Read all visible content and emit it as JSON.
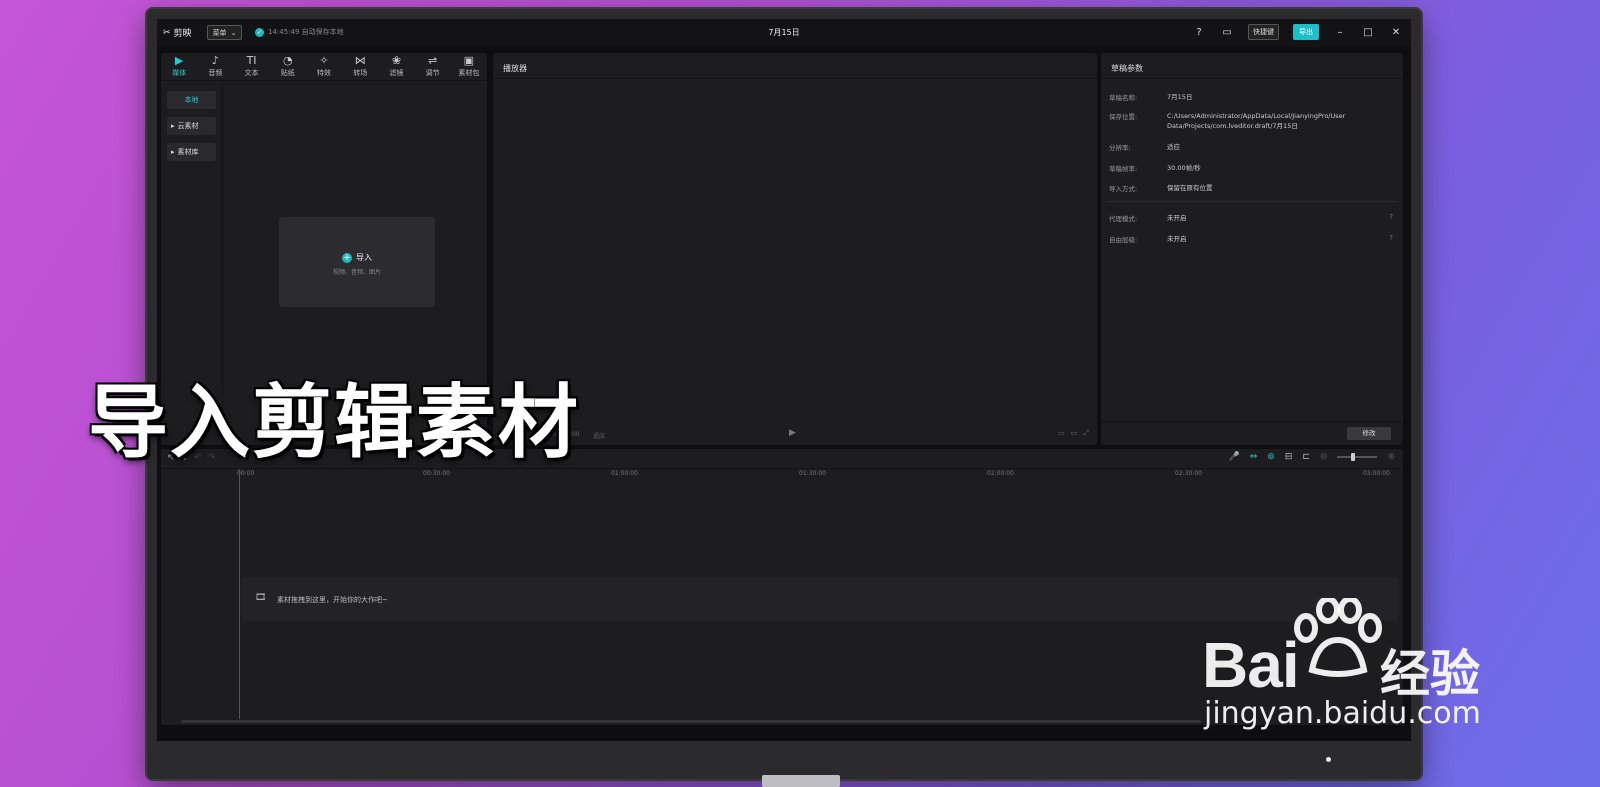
{
  "app": {
    "name": "剪映",
    "menu_label": "菜单",
    "autosave": "14:45:49 自动保存本地",
    "center_title": "7月15日",
    "shortcut_label": "快捷键",
    "export_label": "导出"
  },
  "media_tabs": [
    {
      "label": "媒体",
      "icon": "▶"
    },
    {
      "label": "音频",
      "icon": "♪"
    },
    {
      "label": "文本",
      "icon": "TI"
    },
    {
      "label": "贴纸",
      "icon": "◔"
    },
    {
      "label": "特效",
      "icon": "✧"
    },
    {
      "label": "转场",
      "icon": "⋈"
    },
    {
      "label": "滤镜",
      "icon": "❀"
    },
    {
      "label": "调节",
      "icon": "⇌"
    },
    {
      "label": "素材包",
      "icon": "▣"
    }
  ],
  "media_sidebar": [
    "本地",
    "云素材",
    "素材库"
  ],
  "import": {
    "title": "导入",
    "subtitle": "视频、音频、图片"
  },
  "player": {
    "title": "播放器",
    "time": "00:00:00:00",
    "ratio": "适应"
  },
  "properties": {
    "title": "草稿参数",
    "rows": [
      {
        "k": "草稿名称:",
        "v": "7月15日"
      },
      {
        "k": "保存位置:",
        "v": "C:/Users/Administrator/AppData/Local/JianyingPro/User Data/Projects/com.lveditor.draft/7月15日"
      },
      {
        "k": "分辨率:",
        "v": "适应"
      },
      {
        "k": "草稿帧率:",
        "v": "30.00帧/秒"
      },
      {
        "k": "导入方式:",
        "v": "保留在原有位置"
      }
    ],
    "rows2": [
      {
        "k": "代理模式:",
        "v": "未开启"
      },
      {
        "k": "自由层级:",
        "v": "未开启"
      }
    ],
    "modify_label": "修改"
  },
  "timeline": {
    "ticks": [
      "00:00",
      "00:30:00",
      "01:00:00",
      "01:30:00",
      "02:00:00",
      "02:30:00",
      "03:00:00"
    ],
    "drop_hint": "素材拖拽到这里，开始你的大作吧~"
  },
  "overlay_caption": "导入剪辑素材",
  "watermark": {
    "brand": "Bai",
    "brand_cn": "经验",
    "url": "jingyan.baidu.com"
  },
  "colors": {
    "accent": "#1fbfc9",
    "background_gradient": [
      "#c455d6",
      "#6c6ee8"
    ]
  }
}
